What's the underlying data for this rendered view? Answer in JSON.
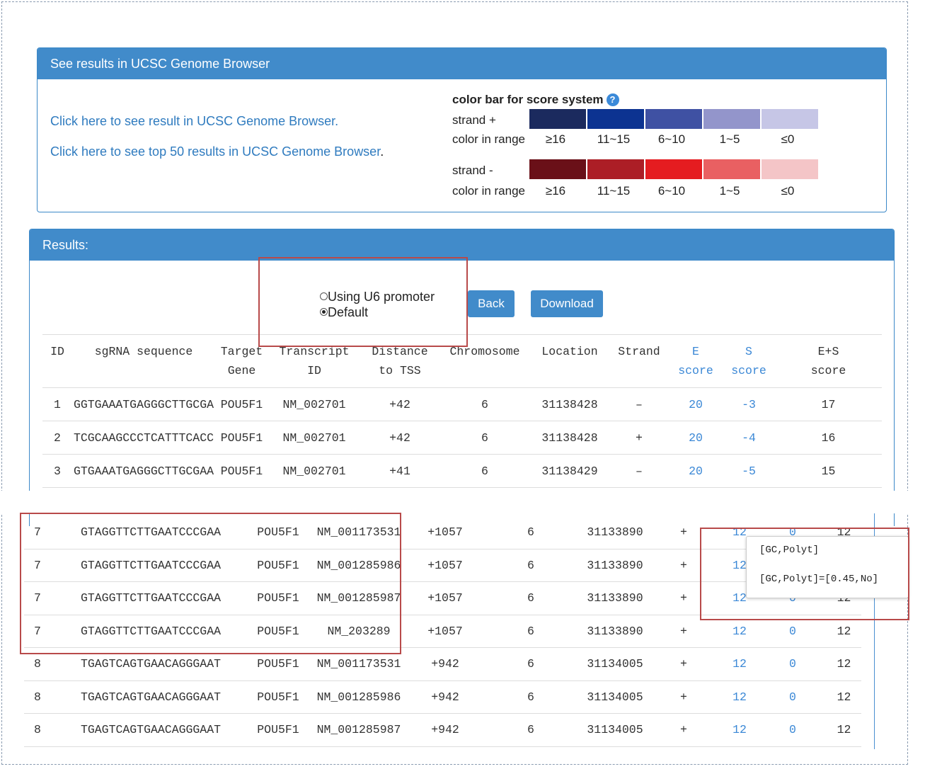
{
  "ucsc_panel": {
    "title": "See results in UCSC Genome Browser",
    "link1": "Click here to see result in UCSC Genome Browser.",
    "link2": "Click here to see top 50 results in UCSC Genome Browser",
    "link2_suffix": "."
  },
  "color_bar": {
    "title": "color bar for score system",
    "help_glyph": "?",
    "strand_plus_label": "strand +",
    "strand_minus_label": "strand -",
    "range_label": "color in range",
    "ranges": [
      "≥16",
      "11~15",
      "6~10",
      "1~5",
      "≤0"
    ],
    "plus_colors": [
      "#1b2a5e",
      "#0c3391",
      "#3f51a3",
      "#9395cb",
      "#c6c6e6"
    ],
    "minus_colors": [
      "#6a1018",
      "#ac1e26",
      "#e51c20",
      "#e96062",
      "#f4c5c7"
    ]
  },
  "results_panel": {
    "title": "Results:",
    "radio_u6": "Using U6 promoter",
    "radio_default": "Default",
    "back_label": "Back",
    "download_label": "Download"
  },
  "table_headers": [
    [
      "ID"
    ],
    [
      "sgRNA sequence"
    ],
    [
      "Target",
      "Gene"
    ],
    [
      "Transcript",
      "ID"
    ],
    [
      "Distance",
      "to TSS"
    ],
    [
      "Chromosome"
    ],
    [
      "Location"
    ],
    [
      "Strand"
    ],
    [
      "E",
      "score"
    ],
    [
      "S",
      "score"
    ],
    [
      "E+S",
      "score"
    ]
  ],
  "top_rows": [
    [
      "1",
      "GGTGAAATGAGGGCTTGCGA",
      "POU5F1",
      "NM_002701",
      "+42",
      "6",
      "31138428",
      "–",
      "20",
      "-3",
      "17"
    ],
    [
      "2",
      "TCGCAAGCCCTCATTTCACC",
      "POU5F1",
      "NM_002701",
      "+42",
      "6",
      "31138428",
      "+",
      "20",
      "-4",
      "16"
    ],
    [
      "3",
      "GTGAAATGAGGGCTTGCGAA",
      "POU5F1",
      "NM_002701",
      "+41",
      "6",
      "31138429",
      "–",
      "20",
      "-5",
      "15"
    ]
  ],
  "bottom_rows": [
    [
      "7",
      "GTAGGTTCTTGAATCCCGAA",
      "POU5F1",
      "NM_001173531",
      "+1057",
      "6",
      "31133890",
      "+",
      "12",
      "0",
      "12"
    ],
    [
      "7",
      "GTAGGTTCTTGAATCCCGAA",
      "POU5F1",
      "NM_001285986",
      "+1057",
      "6",
      "31133890",
      "+",
      "12",
      "0",
      "12"
    ],
    [
      "7",
      "GTAGGTTCTTGAATCCCGAA",
      "POU5F1",
      "NM_001285987",
      "+1057",
      "6",
      "31133890",
      "+",
      "12",
      "0",
      "12"
    ],
    [
      "7",
      "GTAGGTTCTTGAATCCCGAA",
      "POU5F1",
      "NM_203289",
      "+1057",
      "6",
      "31133890",
      "+",
      "12",
      "0",
      "12"
    ],
    [
      "8",
      "TGAGTCAGTGAACAGGGAAT",
      "POU5F1",
      "NM_001173531",
      "+942",
      "6",
      "31134005",
      "+",
      "12",
      "0",
      "12"
    ],
    [
      "8",
      "TGAGTCAGTGAACAGGGAAT",
      "POU5F1",
      "NM_001285986",
      "+942",
      "6",
      "31134005",
      "+",
      "12",
      "0",
      "12"
    ],
    [
      "8",
      "TGAGTCAGTGAACAGGGAAT",
      "POU5F1",
      "NM_001285987",
      "+942",
      "6",
      "31134005",
      "+",
      "12",
      "0",
      "12"
    ]
  ],
  "tooltip": {
    "line1": "[GC,Polyt]",
    "line2": "[GC,Polyt]=[0.45,No]"
  },
  "colors": {
    "panel_blue": "#418bca",
    "link_blue": "#2f7bbf",
    "score_blue": "#3b88d6",
    "highlight_red": "#b84a4a"
  }
}
